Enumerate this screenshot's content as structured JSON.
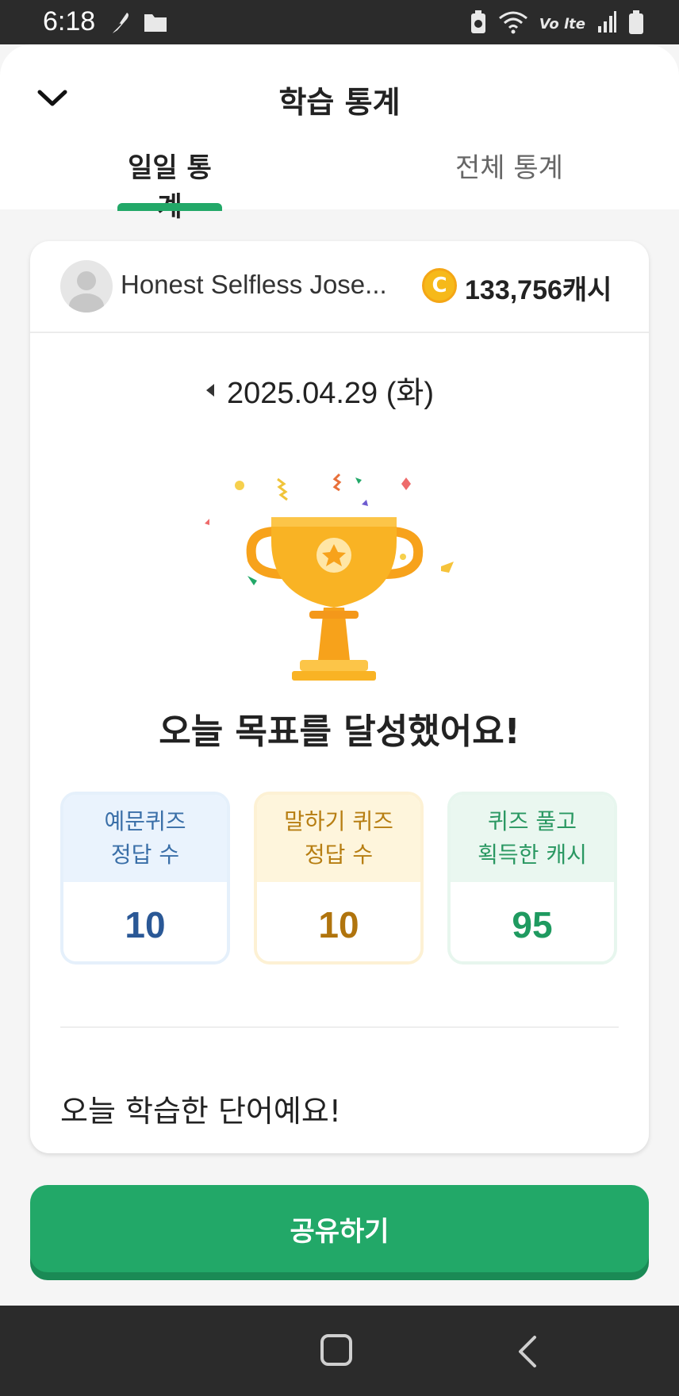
{
  "status_bar": {
    "time": "6:18",
    "icons": [
      "feather-icon",
      "folder-icon",
      "battery-saver-icon",
      "wifi-icon",
      "volte-icon",
      "signal-icon",
      "battery-icon"
    ],
    "volte_label": "Vo lte"
  },
  "header": {
    "title": "학습 통계",
    "back_icon": "chevron-down-icon"
  },
  "tabs": [
    {
      "label": "일일 통계",
      "active": true
    },
    {
      "label": "전체 통계",
      "active": false
    }
  ],
  "accent_color": "#22a868",
  "user": {
    "name": "Honest Selfless Jose...",
    "coin_symbol": "C",
    "cash": "133,756캐시"
  },
  "date": {
    "label": "2025.04.29 (화)",
    "prev_icon": "caret-left-icon"
  },
  "goal_message": "오늘 목표를 달성했어요!",
  "stats": [
    {
      "line1": "예문퀴즈",
      "line2": "정답 수",
      "value": "10"
    },
    {
      "line1": "말하기 퀴즈",
      "line2": "정답 수",
      "value": "10"
    },
    {
      "line1": "퀴즈 풀고",
      "line2": "획득한 캐시",
      "value": "95"
    }
  ],
  "words_title": "오늘 학습한 단어예요!",
  "share_button": "공유하기",
  "nav_bar": {
    "home_icon": "home-square-icon",
    "back_icon": "back-chevron-icon"
  }
}
